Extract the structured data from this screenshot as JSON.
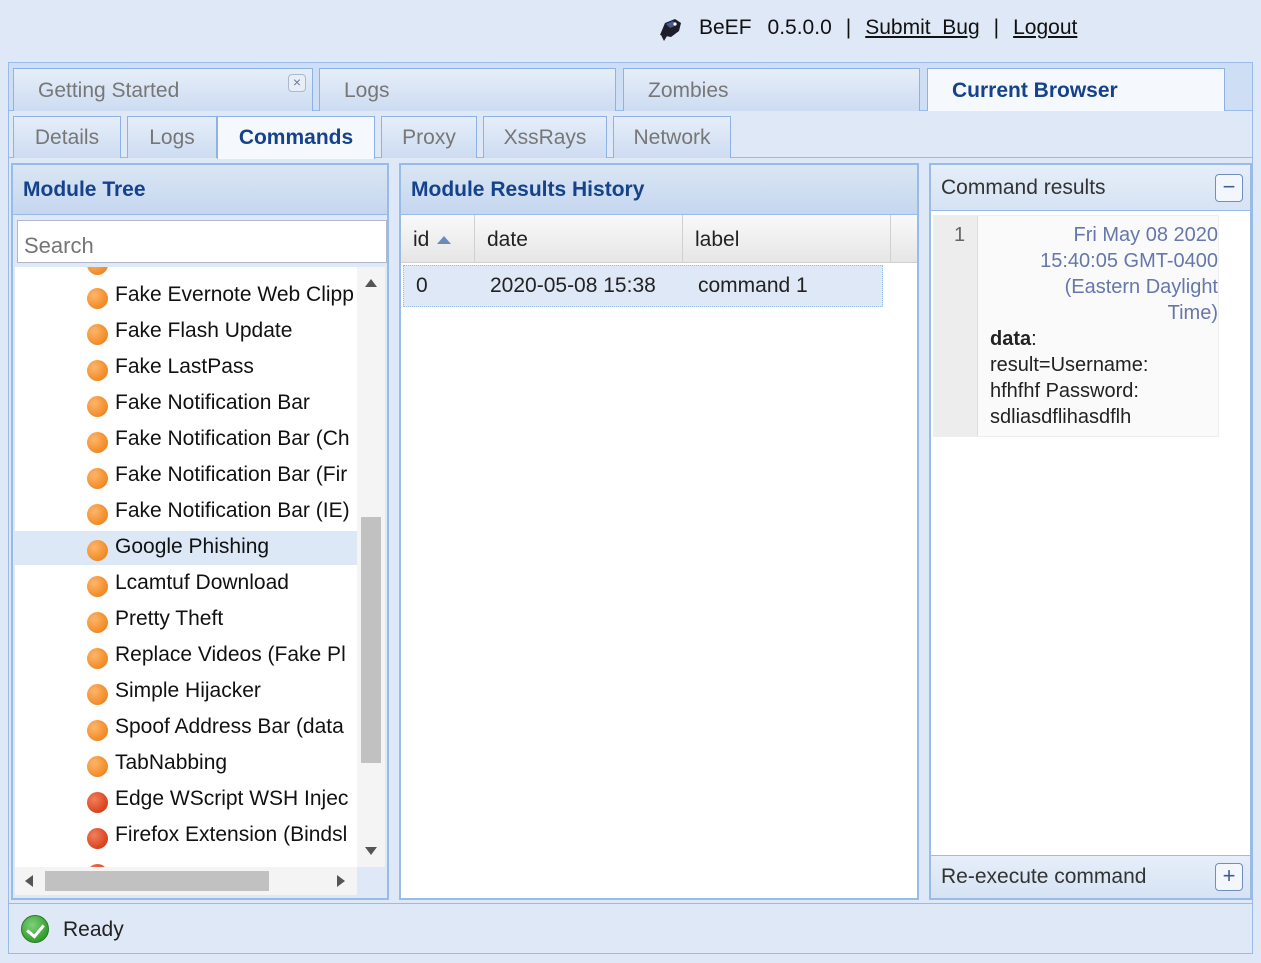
{
  "header": {
    "app_name": "BeEF",
    "version": "0.5.0.0",
    "separator": "|",
    "submit_bug": "Submit  Bug",
    "logout": "Logout"
  },
  "main_tabs": [
    {
      "label": "Getting Started",
      "closable": true
    },
    {
      "label": "Logs"
    },
    {
      "label": "Zombies"
    },
    {
      "label": "Current Browser",
      "active": true
    }
  ],
  "sub_tabs": [
    {
      "label": "Details"
    },
    {
      "label": "Logs"
    },
    {
      "label": "Commands",
      "active": true
    },
    {
      "label": "Proxy"
    },
    {
      "label": "XssRays"
    },
    {
      "label": "Network"
    }
  ],
  "module_tree": {
    "title": "Module Tree",
    "search_placeholder": "Search",
    "items": [
      {
        "label": "Fake Evernote Web Clipp",
        "color": "orange"
      },
      {
        "label": "Fake Flash Update",
        "color": "orange"
      },
      {
        "label": "Fake LastPass",
        "color": "orange"
      },
      {
        "label": "Fake Notification Bar",
        "color": "orange"
      },
      {
        "label": "Fake Notification Bar (Ch",
        "color": "orange"
      },
      {
        "label": "Fake Notification Bar (Fir",
        "color": "orange"
      },
      {
        "label": "Fake Notification Bar (IE)",
        "color": "orange"
      },
      {
        "label": "Google Phishing",
        "color": "orange",
        "selected": true
      },
      {
        "label": "Lcamtuf Download",
        "color": "orange"
      },
      {
        "label": "Pretty Theft",
        "color": "orange"
      },
      {
        "label": "Replace Videos (Fake Pl",
        "color": "orange"
      },
      {
        "label": "Simple Hijacker",
        "color": "orange"
      },
      {
        "label": "Spoof Address Bar (data",
        "color": "orange"
      },
      {
        "label": "TabNabbing",
        "color": "orange"
      },
      {
        "label": "Edge WScript WSH Injec",
        "color": "red"
      },
      {
        "label": "Firefox Extension (Bindsl",
        "color": "red"
      }
    ]
  },
  "results_history": {
    "title": "Module Results History",
    "columns": [
      "id",
      "date",
      "label"
    ],
    "rows": [
      {
        "id": "0",
        "date": "2020-05-08 15:38",
        "label": "command 1"
      }
    ]
  },
  "command_results": {
    "title": "Command results",
    "collapse_icon": "minus-icon",
    "entry_number": "1",
    "date_lines": [
      "Fri May 08 2020",
      "15:40:05 GMT-0400",
      "(Eastern Daylight",
      "Time)"
    ],
    "data_key": "data",
    "data_lines": [
      "result=Username:",
      "hfhfhf Password:",
      "sdliasdflihasdflh"
    ],
    "reexecute_label": "Re-execute command",
    "expand_icon": "plus-icon"
  },
  "status": {
    "text": "Ready"
  },
  "colors": {
    "accent": "#15428b",
    "border": "#99bbe8",
    "panel_bg": "#dfe8f6",
    "module_orange": "#f08a24",
    "module_red": "#d9421c"
  }
}
